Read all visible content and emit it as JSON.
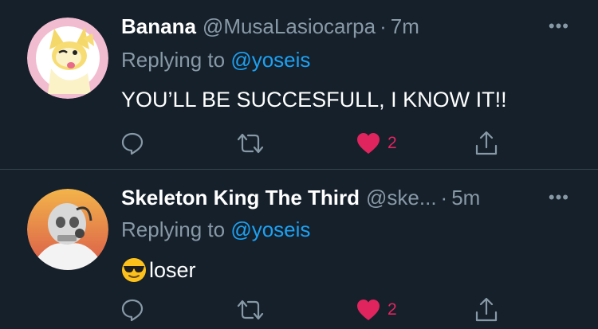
{
  "tweets": [
    {
      "display_name": "Banana",
      "handle": "@MusaLasiocarpa",
      "separator": "·",
      "time": "7m",
      "replying_prefix": "Replying to",
      "replying_to": "@yoseis",
      "text": "YOU’LL BE SUCCESFULL, I KNOW IT!!",
      "like_count": "2",
      "more_label": "•••"
    },
    {
      "display_name": "Skeleton King The Third",
      "handle": "@ske...",
      "separator": "·",
      "time": "5m",
      "replying_prefix": "Replying to",
      "replying_to": "@yoseis",
      "text": "loser",
      "like_count": "2",
      "more_label": "•••"
    }
  ],
  "icons": {
    "reply": "reply-icon",
    "retweet": "retweet-icon",
    "like": "heart-icon",
    "share": "share-icon",
    "emoji": "sunglasses-emoji-icon"
  },
  "colors": {
    "background": "#15202b",
    "muted": "#8899a6",
    "link": "#1da1f2",
    "like": "#e0245e",
    "divider": "#38444d"
  }
}
